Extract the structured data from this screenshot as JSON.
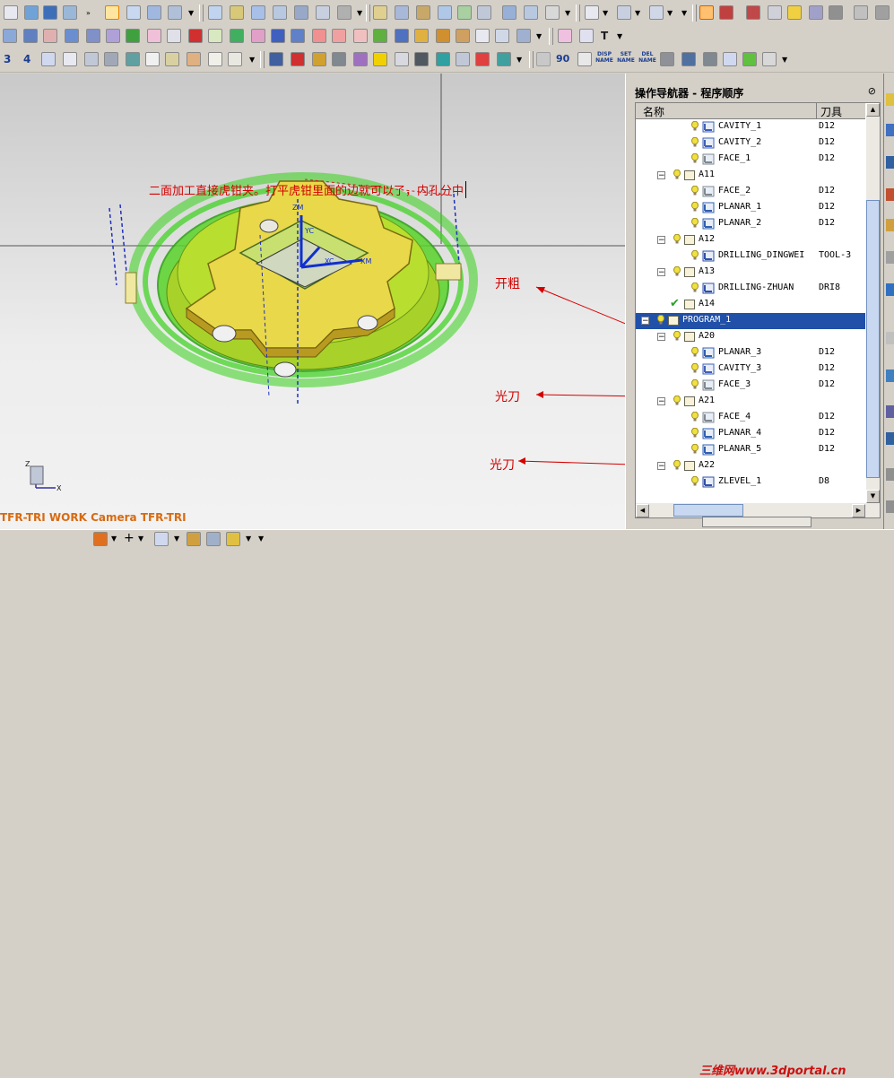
{
  "viewport": {
    "annotation": "二面加工直接虎钳夹。打平虎钳里面的边就可以了，内孔分中",
    "labels": [
      "开粗",
      "光刀",
      "光刀"
    ],
    "camera_label": "TFR-TRI WORK Camera TFR-TRI",
    "axis_labels": {
      "zm": "ZM",
      "xc": "XC",
      "xm": "XM",
      "yc": "YC"
    },
    "triad": {
      "z": "Z",
      "x": "X"
    }
  },
  "toolbar": {
    "text_buttons": {
      "t": "T",
      "num3": "3",
      "num4": "4",
      "num90": "90",
      "disp_name": "DISP NAME",
      "set_name": "SET NAME",
      "del_name": "DEL NAME"
    }
  },
  "navigator": {
    "title": "操作导航器 - 程序顺序",
    "columns": {
      "name": "名称",
      "tool": "刀具"
    },
    "rows": [
      {
        "name": "CAVITY_1",
        "tool": "D12",
        "kind": "op",
        "icon": "cavity-mill-icon"
      },
      {
        "name": "CAVITY_2",
        "tool": "D12",
        "kind": "op",
        "icon": "cavity-mill-icon"
      },
      {
        "name": "FACE_1",
        "tool": "D12",
        "kind": "op",
        "icon": "face-mill-icon"
      },
      {
        "name": "A11",
        "tool": "",
        "kind": "group"
      },
      {
        "name": "FACE_2",
        "tool": "D12",
        "kind": "op",
        "icon": "face-mill-icon"
      },
      {
        "name": "PLANAR_1",
        "tool": "D12",
        "kind": "op",
        "icon": "planar-mill-icon"
      },
      {
        "name": "PLANAR_2",
        "tool": "D12",
        "kind": "op",
        "icon": "planar-mill-icon"
      },
      {
        "name": "A12",
        "tool": "",
        "kind": "group"
      },
      {
        "name": "DRILLING_DINGWEI",
        "tool": "TOOL-3",
        "kind": "op",
        "icon": "drilling-icon"
      },
      {
        "name": "A13",
        "tool": "",
        "kind": "group"
      },
      {
        "name": "DRILLING-ZHUAN",
        "tool": "DRI8",
        "kind": "op",
        "icon": "drilling-icon"
      },
      {
        "name": "A14",
        "tool": "",
        "kind": "group-check"
      },
      {
        "name": "PROGRAM_1",
        "tool": "",
        "kind": "program"
      },
      {
        "name": "A20",
        "tool": "",
        "kind": "group"
      },
      {
        "name": "PLANAR_3",
        "tool": "D12",
        "kind": "op",
        "icon": "planar-mill-icon"
      },
      {
        "name": "CAVITY_3",
        "tool": "D12",
        "kind": "op",
        "icon": "cavity-mill-icon"
      },
      {
        "name": "FACE_3",
        "tool": "D12",
        "kind": "op",
        "icon": "face-mill-icon"
      },
      {
        "name": "A21",
        "tool": "",
        "kind": "group"
      },
      {
        "name": "FACE_4",
        "tool": "D12",
        "kind": "op",
        "icon": "face-mill-icon"
      },
      {
        "name": "PLANAR_4",
        "tool": "D12",
        "kind": "op",
        "icon": "planar-mill-icon"
      },
      {
        "name": "PLANAR_5",
        "tool": "D12",
        "kind": "op",
        "icon": "planar-mill-icon"
      },
      {
        "name": "A22",
        "tool": "",
        "kind": "group"
      },
      {
        "name": "ZLEVEL_1",
        "tool": "D8",
        "kind": "op",
        "icon": "zlevel-mill-icon"
      }
    ],
    "selected_row": "PROGRAM_1"
  },
  "watermark": "三维网www.3dportal.cn",
  "colors": {
    "annotation_red": "#d40000",
    "toolpath_green": "#39d21a",
    "part_yellow": "#e8d84a",
    "selection_blue": "#2050a8",
    "camera_label_orange": "#d86a10"
  }
}
